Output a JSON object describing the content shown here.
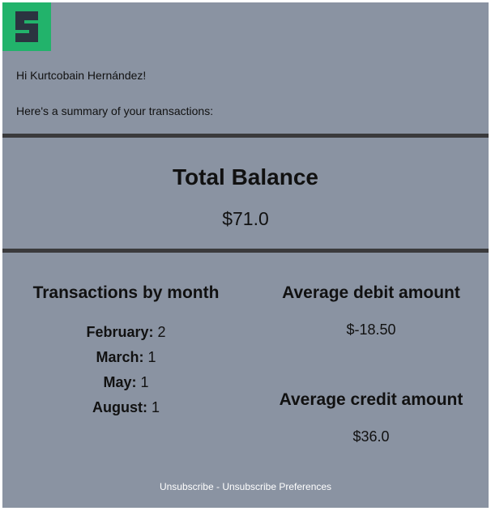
{
  "brand": {
    "logo_color": "#22b36b",
    "logo_mark_color": "#2b3440"
  },
  "greeting": "Hi Kurtcobain Hernández!",
  "intro": "Here's a summary of your transactions:",
  "balance": {
    "title": "Total Balance",
    "value": "$71.0"
  },
  "by_month": {
    "title": "Transactions by month",
    "items": [
      {
        "month": "February:",
        "count": "2"
      },
      {
        "month": "March:",
        "count": "1"
      },
      {
        "month": "May:",
        "count": "1"
      },
      {
        "month": "August:",
        "count": "1"
      }
    ]
  },
  "debit": {
    "title": "Average debit amount",
    "value": "$-18.50"
  },
  "credit": {
    "title": "Average credit amount",
    "value": "$36.0"
  },
  "footer": {
    "unsubscribe": "Unsubscribe",
    "separator": " - ",
    "preferences": "Unsubscribe Preferences"
  },
  "colors": {
    "card_bg": "#8a93a2",
    "divider": "#3a3a3c"
  }
}
